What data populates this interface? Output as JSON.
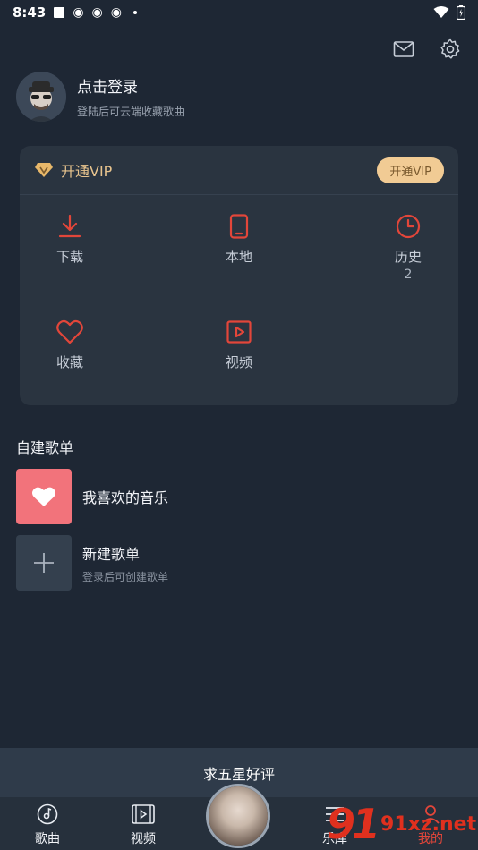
{
  "status": {
    "time": "8:43"
  },
  "profile": {
    "title": "点击登录",
    "subtitle": "登陆后可云端收藏歌曲"
  },
  "vip": {
    "title": "开通VIP",
    "button": "开通VIP",
    "items": [
      {
        "label": "下载",
        "icon": "download-icon"
      },
      {
        "label": "本地",
        "icon": "phone-icon"
      },
      {
        "label": "历史",
        "icon": "clock-icon",
        "count": "2"
      },
      {
        "label": "收藏",
        "icon": "heart-icon"
      },
      {
        "label": "视频",
        "icon": "video-icon"
      }
    ]
  },
  "playlists": {
    "section_title": "自建歌单",
    "favorite": {
      "name": "我喜欢的音乐"
    },
    "create": {
      "name": "新建歌单",
      "subtitle": "登录后可创建歌单"
    }
  },
  "rate_banner": "求五星好评",
  "tabs": [
    {
      "label": "歌曲",
      "icon": "music-disc-icon"
    },
    {
      "label": "视频",
      "icon": "film-icon"
    },
    {
      "label": "乐库",
      "icon": "menu-icon"
    },
    {
      "label": "我的",
      "icon": "user-icon"
    }
  ],
  "watermark": {
    "brand": "91",
    "site": "91xz.net"
  },
  "colors": {
    "background": "#1e2734",
    "card": "#2a3440",
    "accent_red": "#e2463a",
    "vip_gold": "#f1cb94",
    "favorite_pink": "#f2737b"
  }
}
